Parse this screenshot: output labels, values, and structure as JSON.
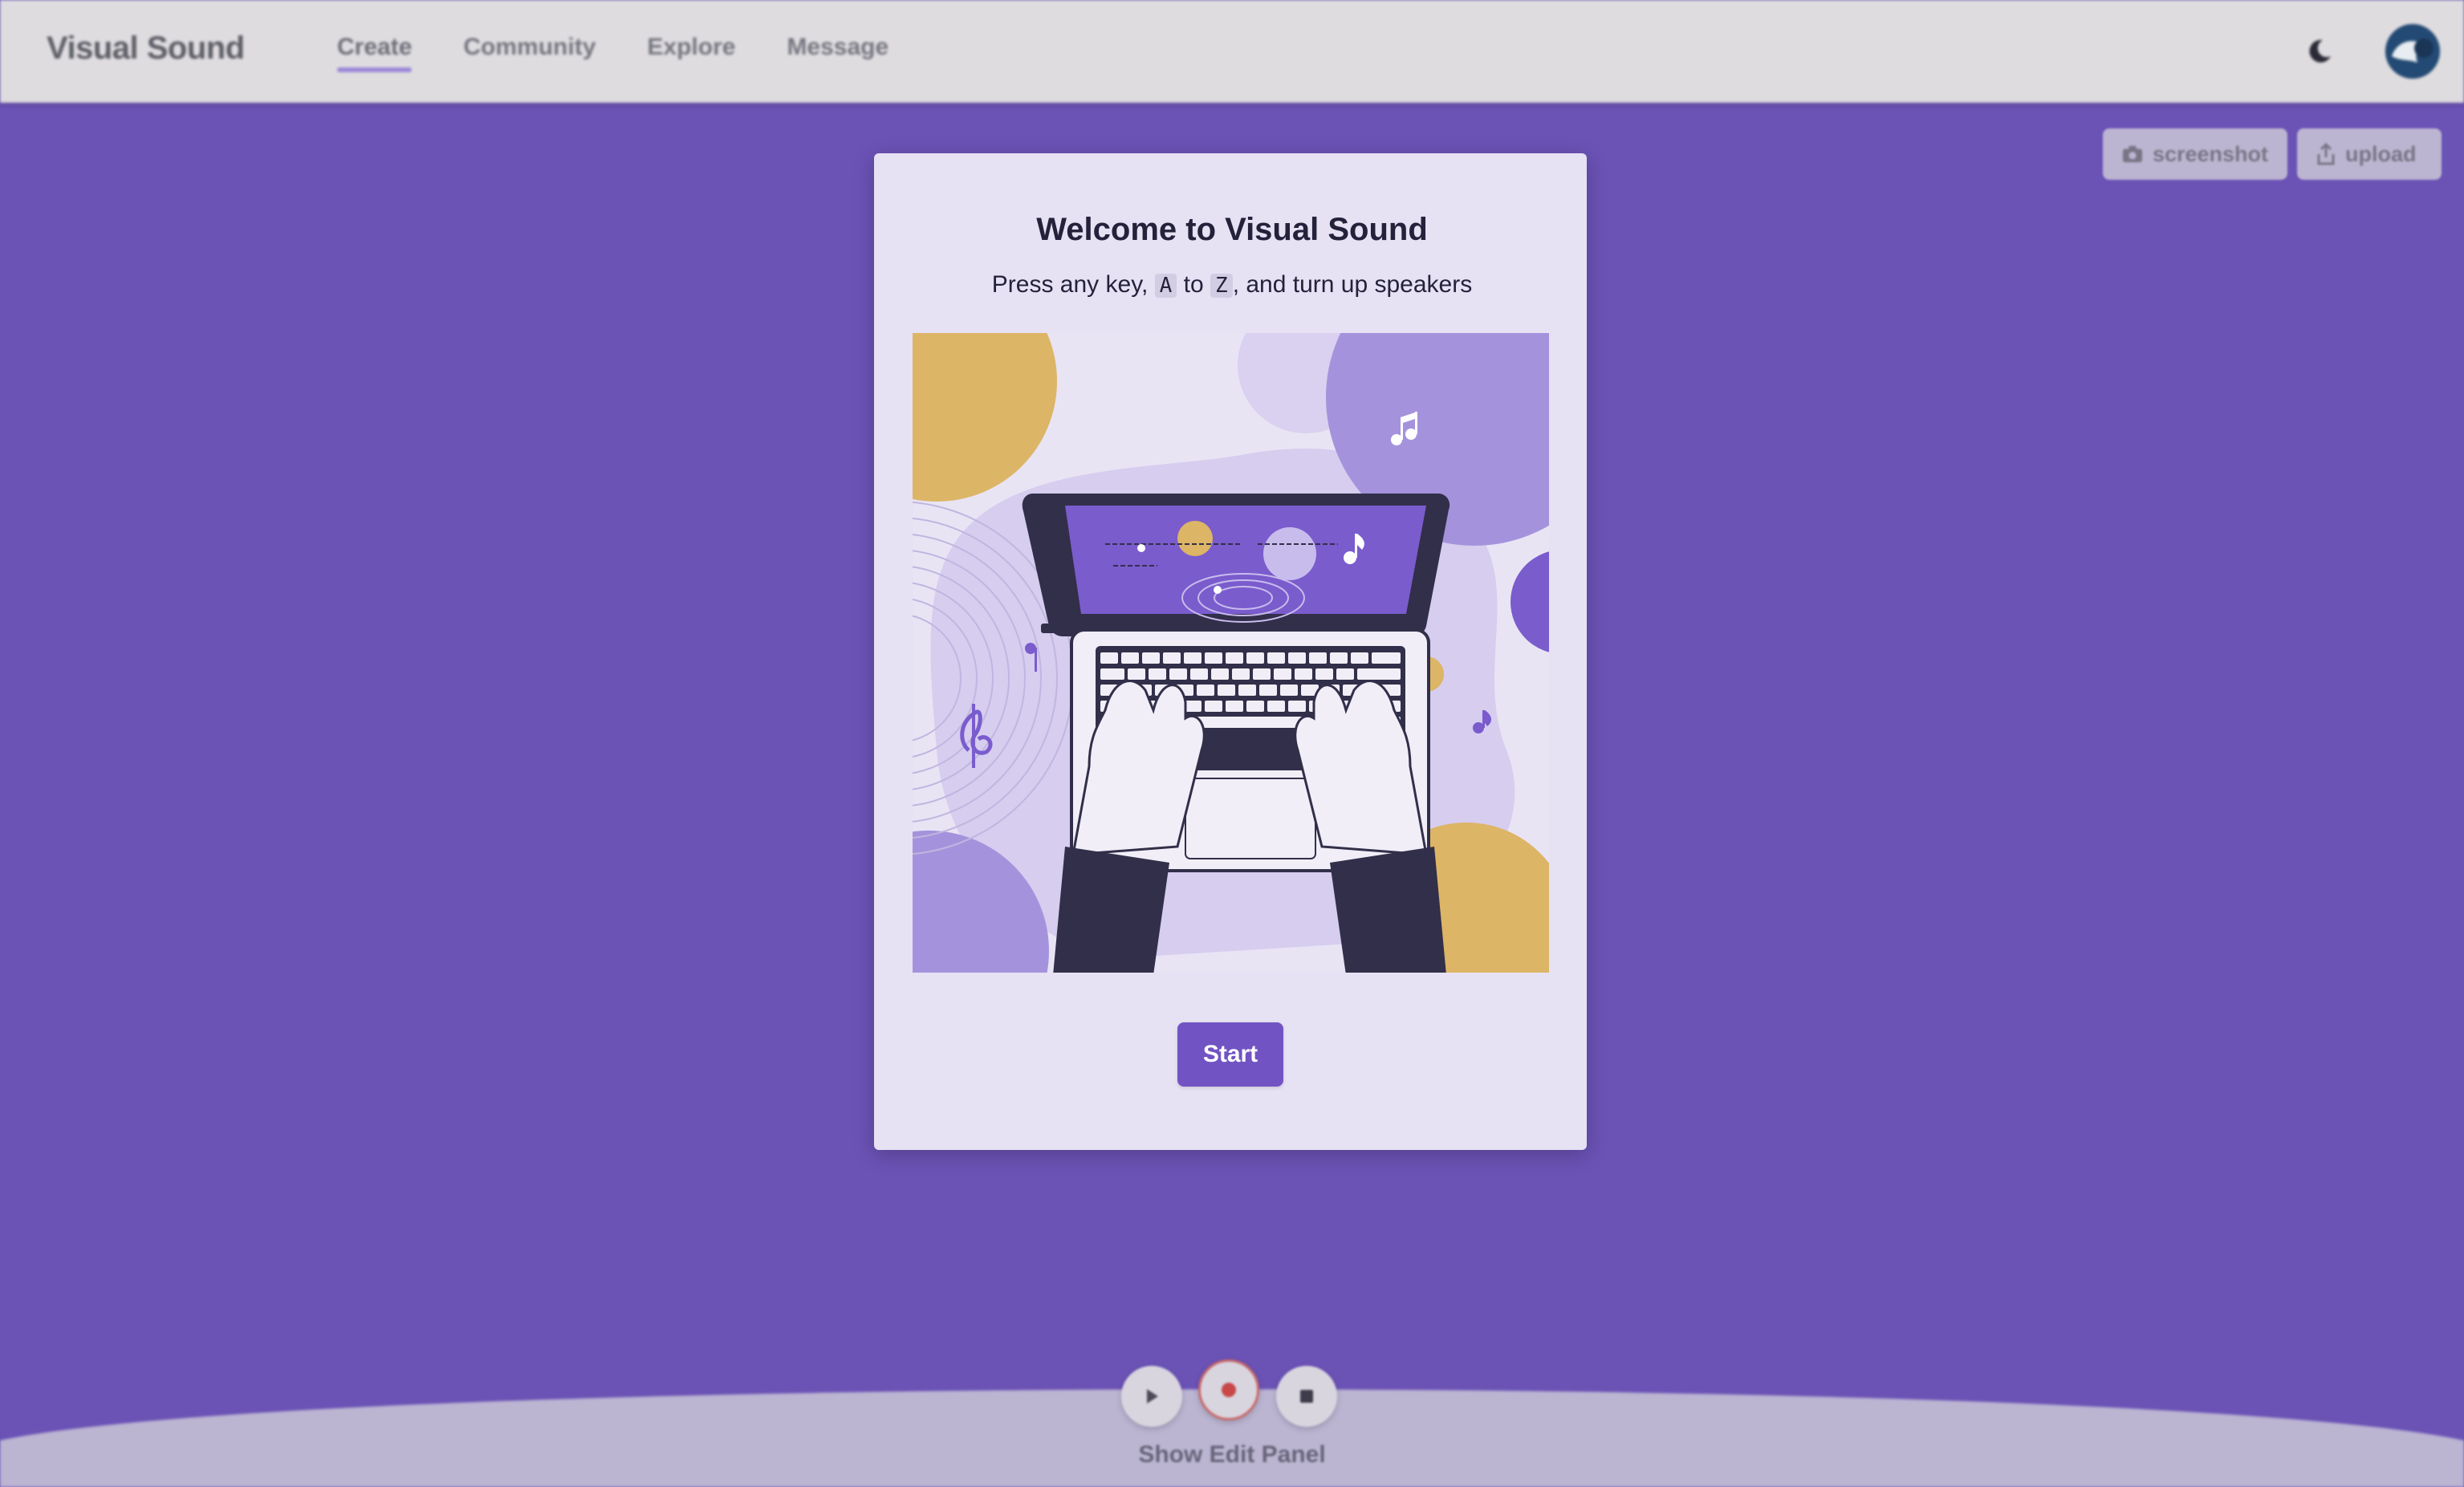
{
  "app": {
    "brand": "Visual Sound",
    "nav": [
      {
        "label": "Create",
        "active": true
      },
      {
        "label": "Community",
        "active": false
      },
      {
        "label": "Explore",
        "active": false
      },
      {
        "label": "Message",
        "active": false
      }
    ],
    "icons": {
      "theme_toggle": "moon-icon",
      "avatar": "user-avatar"
    }
  },
  "actions": {
    "screenshot_label": "screenshot",
    "screenshot_icon": "camera-icon",
    "upload_label": "upload",
    "upload_icon": "upload-icon"
  },
  "welcome": {
    "title": "Welcome to Visual Sound",
    "subtitle_before": "Press any key,",
    "key_from": "A",
    "subtitle_mid": "to",
    "key_to": "Z",
    "subtitle_after": ", and turn up speakers",
    "start_label": "Start"
  },
  "player": {
    "play_icon": "play-icon",
    "record_icon": "record-icon",
    "stop_icon": "stop-icon",
    "edit_panel_label": "Show Edit Panel"
  },
  "colors": {
    "background": "#6b52b5",
    "accent": "#7153c4",
    "card": "#e6e1f3",
    "yellow": "#dcb566",
    "lavender": "#a493dc"
  }
}
